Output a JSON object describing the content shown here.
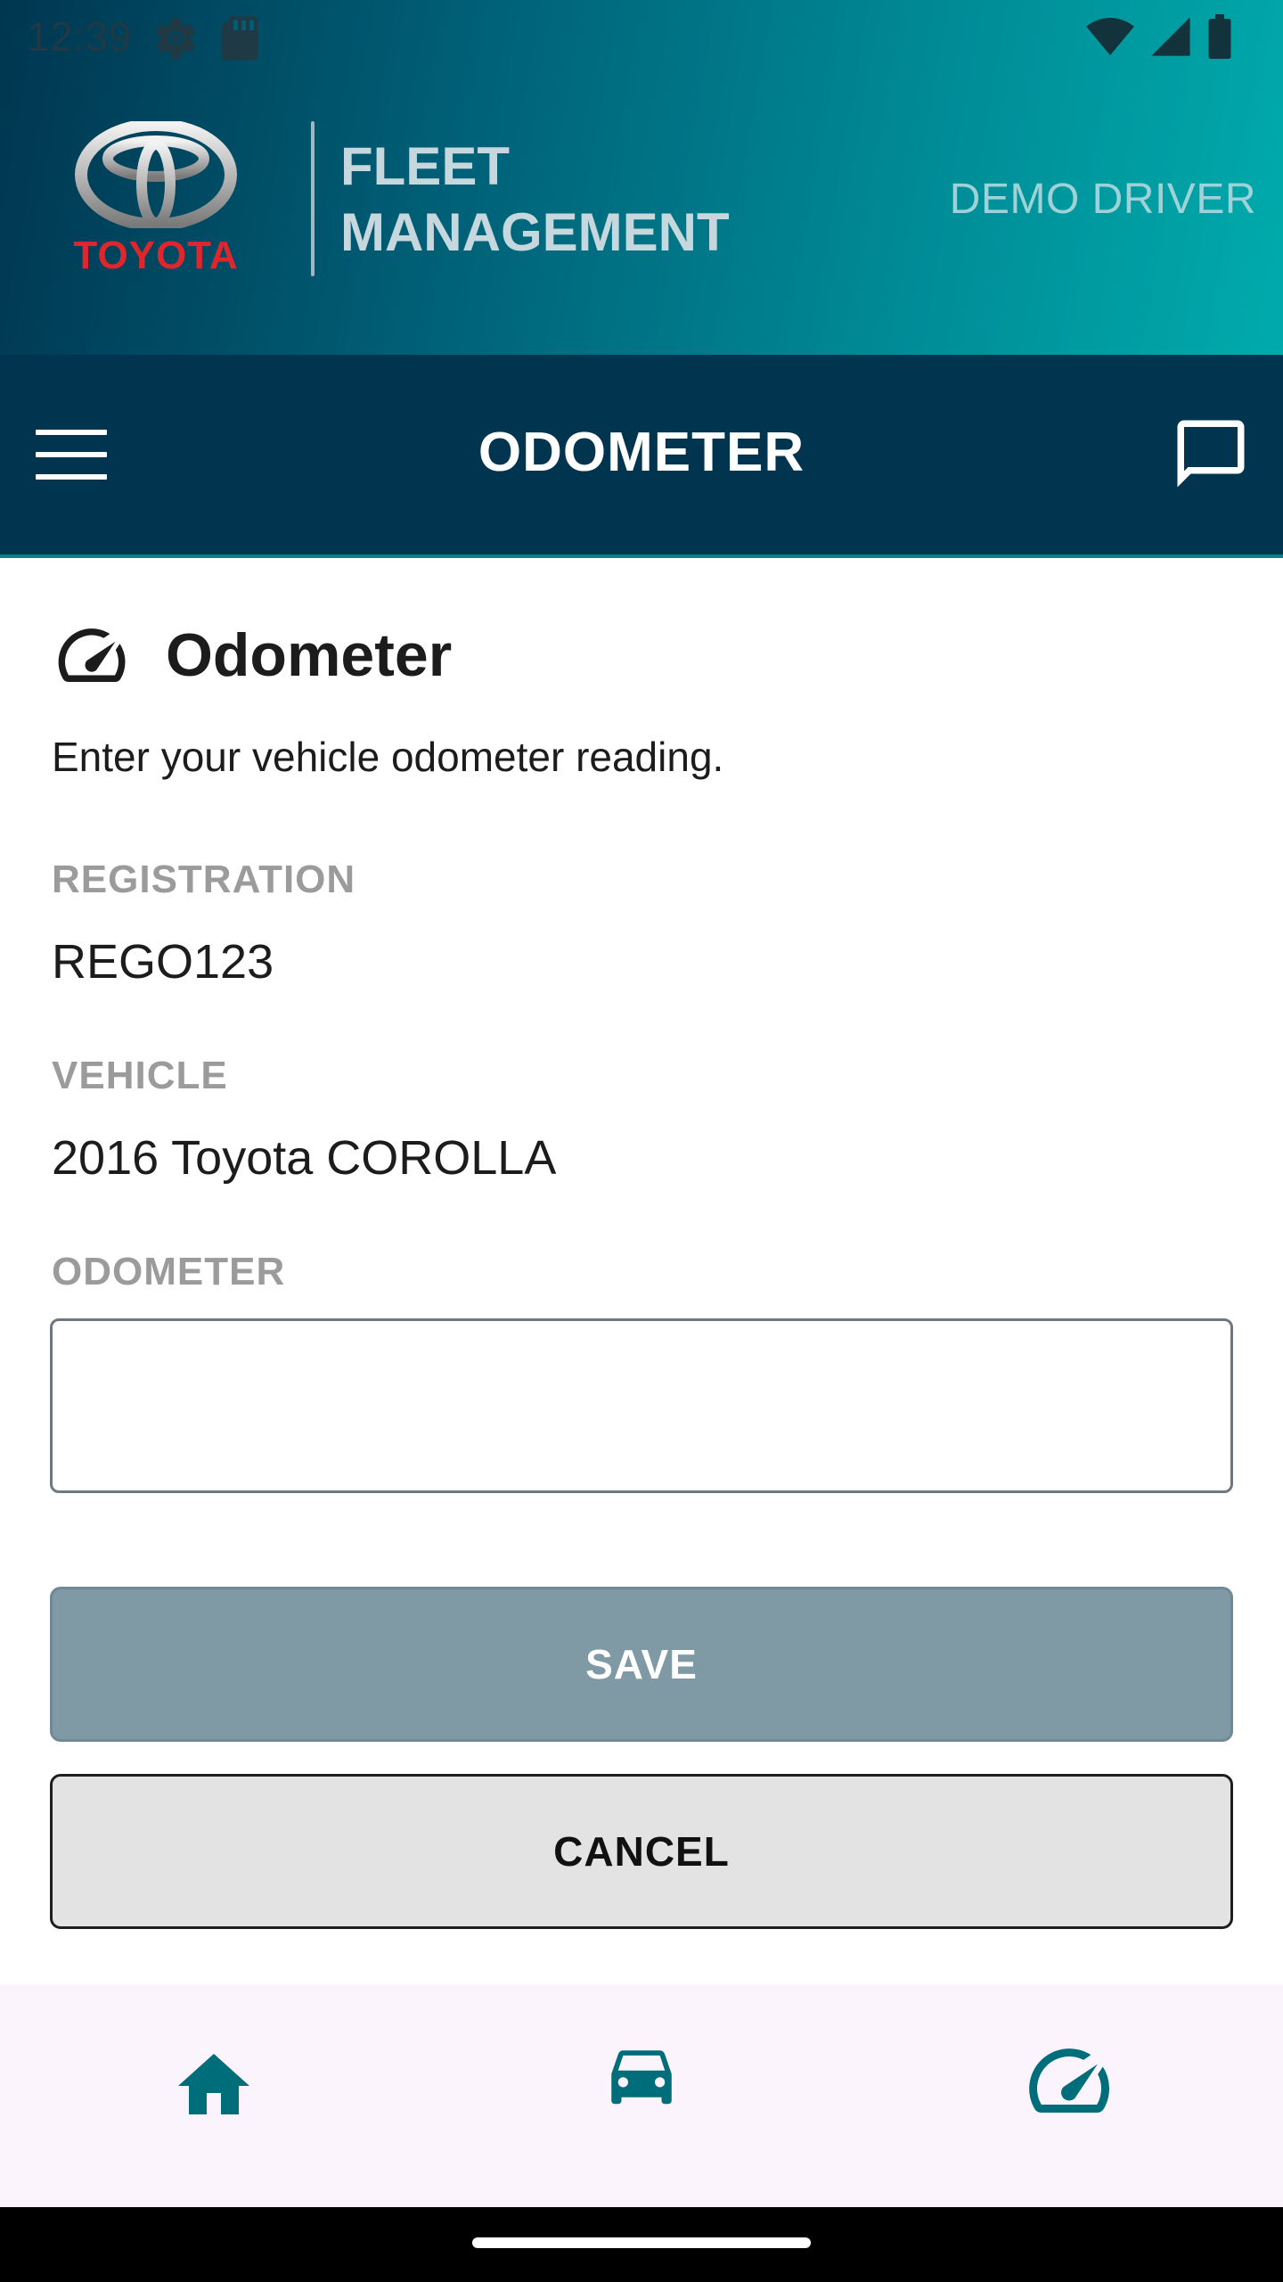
{
  "status_bar": {
    "time": "12:39",
    "left_icons": [
      "settings-icon",
      "sd-card-icon"
    ],
    "right_icons": [
      "wifi-icon",
      "signal-icon",
      "battery-icon"
    ]
  },
  "header": {
    "brand_name": "TOYOTA",
    "app_name_line1": "FLEET",
    "app_name_line2": "MANAGEMENT",
    "user_name": "DEMO DRIVER"
  },
  "toolbar": {
    "title": "ODOMETER",
    "menu_icon": "menu-icon",
    "message_icon": "message-icon"
  },
  "form": {
    "title": "Odometer",
    "title_icon": "speedometer-icon",
    "intro": "Enter your vehicle odometer reading.",
    "registration_label": "REGISTRATION",
    "registration_value": "REGO123",
    "vehicle_label": "VEHICLE",
    "vehicle_value": "2016 Toyota COROLLA",
    "odometer_label": "ODOMETER",
    "odometer_value": "",
    "save_label": "SAVE",
    "cancel_label": "CANCEL"
  },
  "bottom_nav": {
    "items": [
      {
        "icon": "home-icon"
      },
      {
        "icon": "car-icon"
      },
      {
        "icon": "speedometer-icon"
      }
    ]
  },
  "colors": {
    "header_gradient_start": "#003650",
    "header_gradient_end": "#00abac",
    "toolbar": "#01344f",
    "accent": "#006d7a",
    "save_button": "#7f9aa5",
    "cancel_button": "#e3e3e3",
    "brand_red": "#e0262d"
  }
}
